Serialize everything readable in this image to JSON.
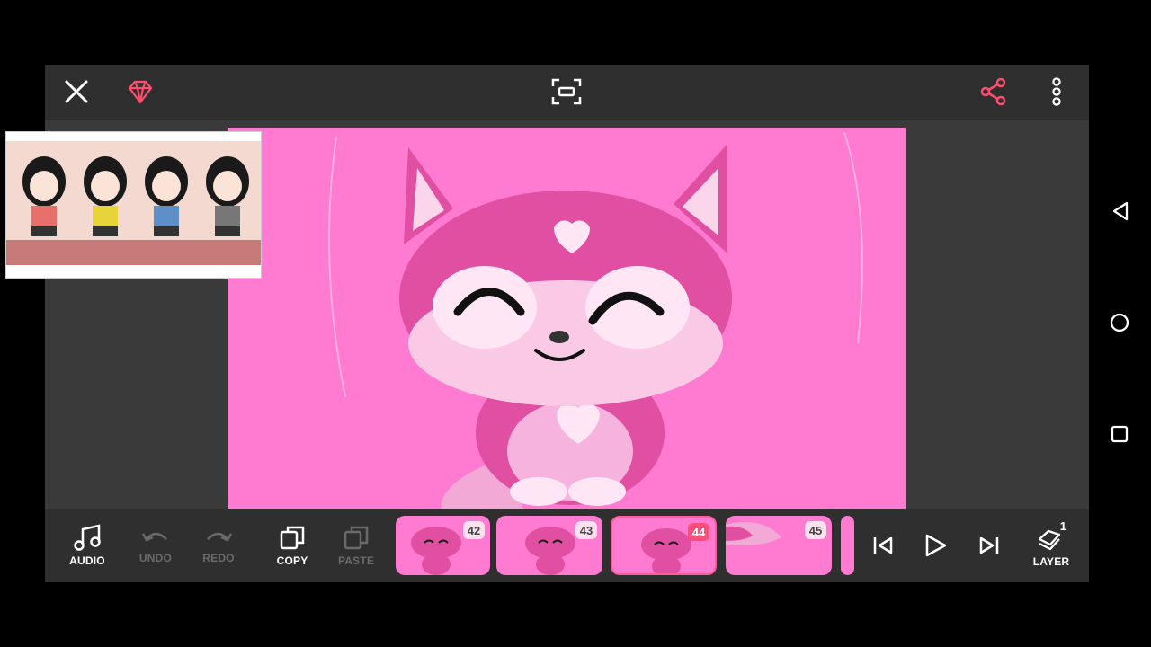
{
  "toolbar": {
    "items": [
      {
        "label": "AUDIO",
        "enabled": true
      },
      {
        "label": "UNDO",
        "enabled": false
      },
      {
        "label": "REDO",
        "enabled": false
      },
      {
        "label": "COPY",
        "enabled": true
      },
      {
        "label": "PASTE",
        "enabled": false
      }
    ],
    "layer_label": "LAYER",
    "layer_count": "1"
  },
  "frames": [
    {
      "number": "42",
      "active": false
    },
    {
      "number": "43",
      "active": false
    },
    {
      "number": "44",
      "active": true
    },
    {
      "number": "45",
      "active": false
    }
  ],
  "colors": {
    "canvas_bg": "#ff7ad1",
    "accent": "#ff4d7a",
    "premium_icon": "#ff4d6d"
  },
  "icons": {
    "close": "close-icon",
    "premium": "diamond-icon",
    "fit_screen": "fit-screen-icon",
    "share": "share-icon",
    "menu": "more-vertical-icon"
  }
}
